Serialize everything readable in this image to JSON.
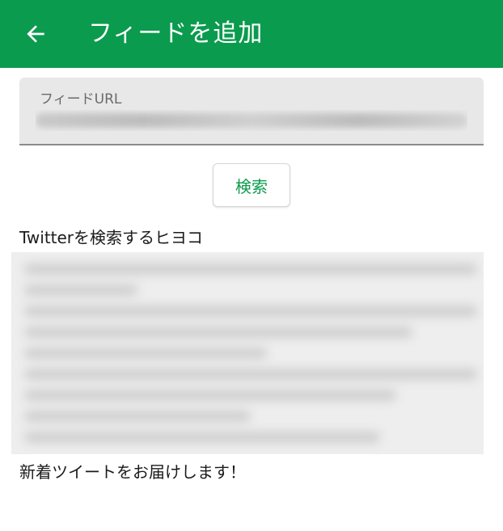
{
  "appbar": {
    "title": "フィードを追加",
    "back_icon": "arrow-left-icon",
    "color": "#0b9b4e"
  },
  "feed_url_field": {
    "label": "フィードURL",
    "value": ""
  },
  "search_button": {
    "label": "検索"
  },
  "feed": {
    "title": "Twitterを検索するヒヨコ",
    "subtitle": "新着ツイートをお届けします！"
  }
}
